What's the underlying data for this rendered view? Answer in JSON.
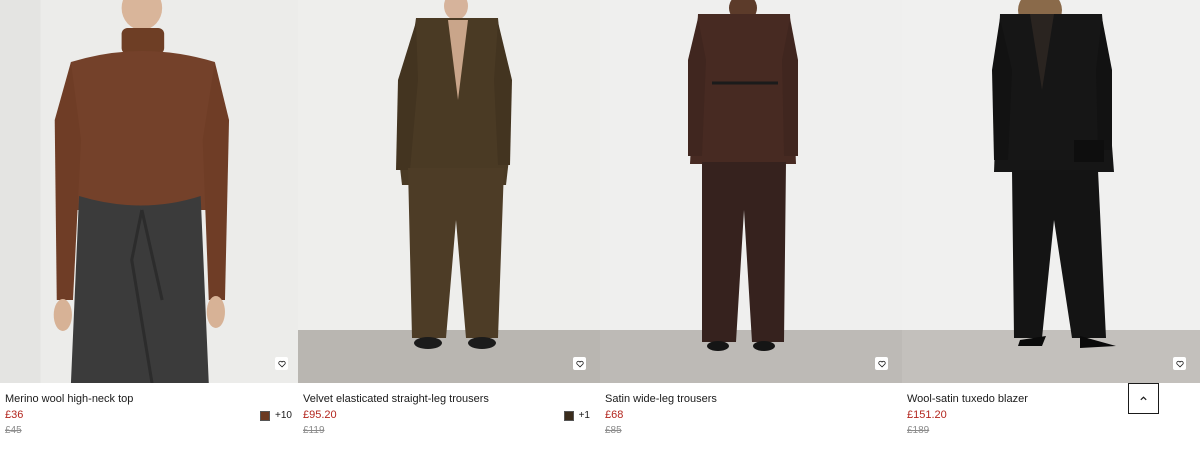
{
  "products": [
    {
      "name": "Merino wool high-neck top",
      "price": "£36",
      "was_price": "£45",
      "swatch_color": "#6b3a22",
      "more_colors": "+10"
    },
    {
      "name": "Velvet elasticated straight-leg trousers",
      "price": "£95.20",
      "was_price": "£119",
      "swatch_color": "#3a2c1c",
      "more_colors": "+1"
    },
    {
      "name": "Satin wide-leg trousers",
      "price": "£68",
      "was_price": "£85"
    },
    {
      "name": "Wool-satin tuxedo blazer",
      "price": "£151.20",
      "was_price": "£189"
    }
  ],
  "icons": {
    "wishlist": "heart-icon",
    "back_to_top": "chevron-up-icon"
  },
  "colors": {
    "sale_price": "#b3261e",
    "was_price": "#8c8c8c"
  }
}
